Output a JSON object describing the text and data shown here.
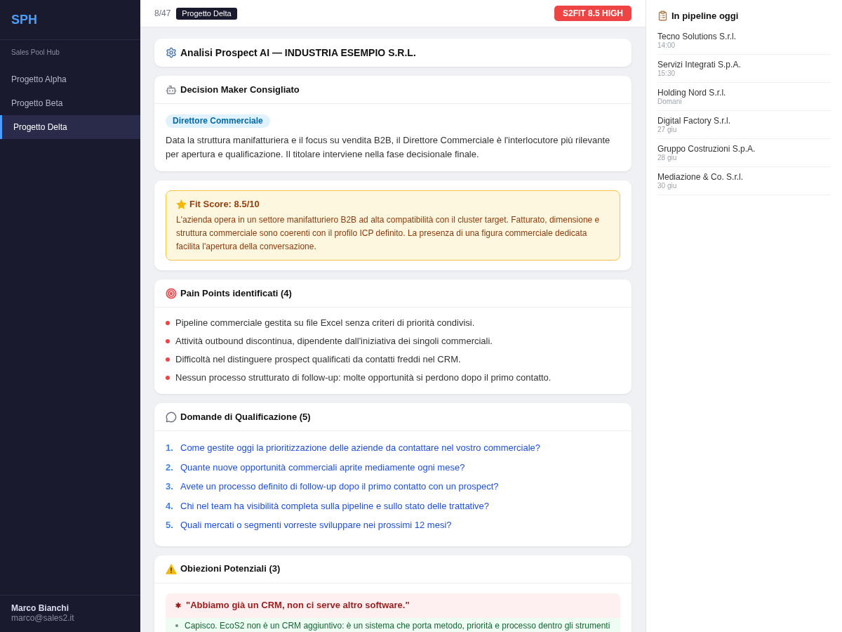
{
  "sidebar": {
    "logo": "SPH",
    "subtitle": "Sales Pool Hub",
    "items": [
      {
        "label": "Progetto Alpha",
        "selected": false
      },
      {
        "label": "Progetto Beta",
        "selected": false
      },
      {
        "label": "Progetto Delta",
        "selected": true
      }
    ],
    "user": {
      "name": "Marco Bianchi",
      "email": "marco@sales2.it"
    }
  },
  "topbar": {
    "counter": "8/47",
    "project": "Progetto Delta",
    "score_badge": "S2FIT 8.5 HIGH"
  },
  "sections": [
    {
      "kind": "title",
      "title": "Analisi Prospect AI — INDUSTRIA ESEMPIO S.R.L."
    },
    {
      "kind": "decision_maker",
      "title": "Decision Maker Consigliato",
      "role": "Direttore Commerciale",
      "text": "Data la struttura manifatturiera e il focus su vendita B2B, il Direttore Commerciale è l'interlocutore più rilevante per apertura e qualificazione. Il titolare interviene nella fase decisionale finale."
    },
    {
      "kind": "fit_score",
      "title": "Fit Score: 8.5/10",
      "text": "L'azienda opera in un settore manifatturiero B2B ad alta compatibilità con il cluster target. Fatturato, dimensione e struttura commerciale sono coerenti con il profilo ICP definito. La presenza di una figura commerciale dedicata facilita l'apertura della conversazione."
    },
    {
      "kind": "bullets",
      "title": "Pain Points identificati (4)",
      "items": [
        "Pipeline commerciale gestita su file Excel senza criteri di priorità condivisi.",
        "Attività outbound discontinua, dipendente dall'iniziativa dei singoli commerciali.",
        "Difficoltà nel distinguere prospect qualificati da contatti freddi nel CRM.",
        "Nessun processo strutturato di follow-up: molte opportunità si perdono dopo il primo contatto."
      ]
    },
    {
      "kind": "numbered",
      "title": "Domande di Qualificazione (5)",
      "items": [
        {
          "number": "1.",
          "text": "Come gestite oggi la prioritizzazione delle aziende da contattare nel vostro commerciale?"
        },
        {
          "number": "2.",
          "text": "Quante nuove opportunità commerciali aprite mediamente ogni mese?"
        },
        {
          "number": "3.",
          "text": "Avete un processo definito di follow-up dopo il primo contatto con un prospect?"
        },
        {
          "number": "4.",
          "text": "Chi nel team ha visibilità completa sulla pipeline e sullo stato delle trattative?"
        },
        {
          "number": "5.",
          "text": "Quali mercati o segmenti vorreste sviluppare nei prossimi 12 mesi?"
        }
      ]
    },
    {
      "kind": "objections",
      "title": "Obiezioni Potenziali (3)",
      "objections": [
        {
          "quote": "\"Abbiamo già un CRM, non ci serve altro software.\"",
          "answer": "Capisco. EcoS2 non è un CRM aggiuntivo: è un sistema che porta metodo, priorità e processo dentro gli strumenti"
        }
      ]
    }
  ],
  "pipeline": {
    "title": "In pipeline oggi",
    "items": [
      {
        "name": "Tecno Solutions S.r.l.",
        "when": "14:00"
      },
      {
        "name": "Servizi Integrati S.p.A.",
        "when": "15:30"
      },
      {
        "name": "Holding Nord S.r.l.",
        "when": "Domani"
      },
      {
        "name": "Digital Factory S.r.l.",
        "when": "27 giu"
      },
      {
        "name": "Gruppo Costruzioni S.p.A.",
        "when": "28 giu"
      },
      {
        "name": "Mediazione & Co. S.r.l.",
        "when": "30 giu"
      }
    ]
  }
}
